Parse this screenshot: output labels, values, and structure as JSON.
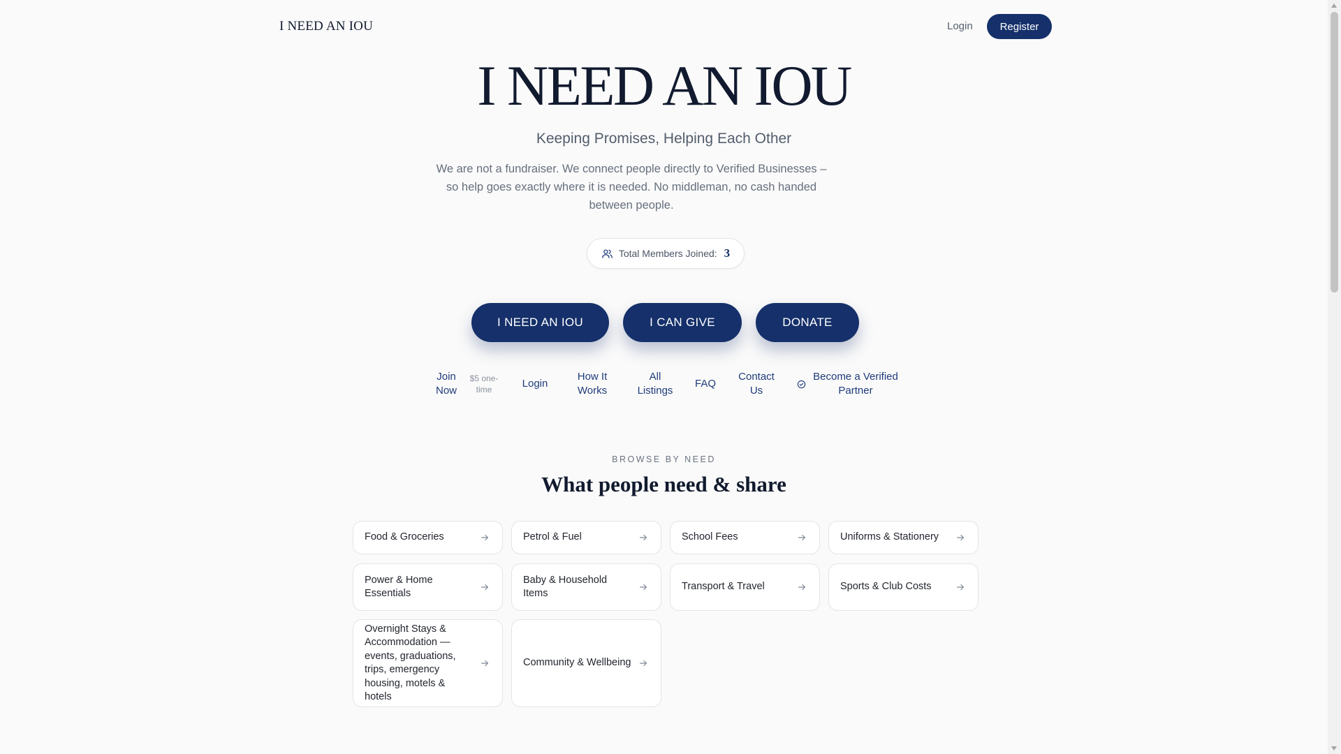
{
  "header": {
    "brand": "I NEED AN IOU",
    "login": "Login",
    "register": "Register"
  },
  "hero": {
    "title": "I NEED AN IOU",
    "tagline": "Keeping Promises, Helping Each Other",
    "intro": "We are not a fundraiser. We connect people directly to Verified Businesses – so help goes exactly where it is needed. No middleman, no cash handed between people.",
    "members_label": "Total Members Joined:",
    "members_count": "3",
    "members_icon": "users-icon"
  },
  "cta": {
    "need": "I NEED AN IOU",
    "give": "I CAN GIVE",
    "donate": "DONATE"
  },
  "quicklinks": {
    "join": "Join Now",
    "join_note": "$5 one-time",
    "login": "Login",
    "how": "How It Works",
    "listings": "All Listings",
    "faq": "FAQ",
    "contact": "Contact Us",
    "partner": "Become a Verified Partner",
    "partner_icon": "verified-check-icon"
  },
  "browse": {
    "eyebrow": "BROWSE BY NEED",
    "title": "What people need & share",
    "arrow_icon": "arrow-right-icon",
    "categories": [
      "Food & Groceries",
      "Petrol & Fuel",
      "School Fees",
      "Uniforms & Stationery",
      "Power & Home Essentials",
      "Baby & Household Items",
      "Transport & Travel",
      "Sports & Club Costs",
      "Overnight Stays & Accommodation — events, graduations, trips, emergency housing, motels & hotels",
      "Community & Wellbeing"
    ]
  },
  "colors": {
    "primary": "#15306a",
    "heading": "#111a2e",
    "link": "#1f3b7a",
    "background": "#fafafa",
    "card_border": "#e1e4ea"
  }
}
